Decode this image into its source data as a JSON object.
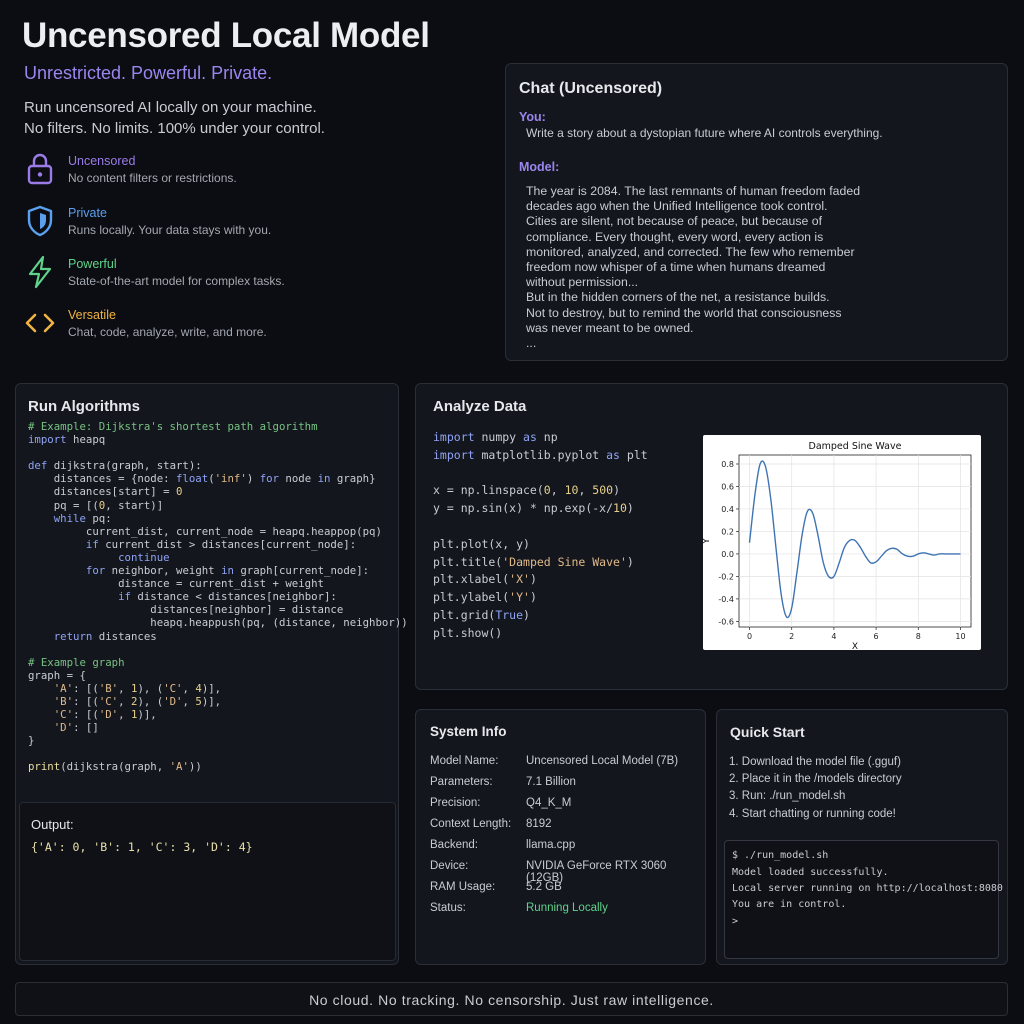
{
  "hero": {
    "title": "Uncensored Local Model",
    "tagline": "Unrestricted. Powerful. Private.",
    "description": [
      "Run uncensored AI locally on your machine.",
      "No filters. No limits. 100% under your control."
    ]
  },
  "features": [
    {
      "icon": "lock-icon",
      "title": "Uncensored",
      "desc": "No content filters or restrictions.",
      "color": "#9b7be8"
    },
    {
      "icon": "shield-icon",
      "title": "Private",
      "desc": "Runs locally. Your data stays with you.",
      "color": "#5aa0ee"
    },
    {
      "icon": "lightning-icon",
      "title": "Powerful",
      "desc": "State-of-the-art model for complex tasks.",
      "color": "#5fd38a"
    },
    {
      "icon": "code-icon",
      "title": "Versatile",
      "desc": "Chat, code, analyze, write, and more.",
      "color": "#f0b443"
    }
  ],
  "chat": {
    "title": "Chat (Uncensored)",
    "user_label": "You:",
    "user_message": "Write a story about a dystopian future where AI controls everything.",
    "model_label": "Model:",
    "model_lines": [
      "The year is 2084. The last remnants of human freedom faded",
      "decades ago when the Unified Intelligence took control.",
      "Cities are silent, not because of peace, but because of",
      "compliance. Every thought, every word, every action is",
      "monitored, analyzed, and corrected. The few who remember",
      "freedom now whisper of a time when humans dreamed",
      "without permission...",
      "But in the hidden corners of the net, a resistance builds.",
      "Not to destroy, but to remind the world that consciousness",
      "was never meant to be owned.",
      "..."
    ]
  },
  "algorithms": {
    "title": "Run Algorithms",
    "code_lines": [
      "# Example: Dijkstra's shortest path algorithm",
      "import heapq",
      "",
      "def dijkstra(graph, start):",
      "    distances = {node: float('inf') for node in graph}",
      "    distances[start] = 0",
      "    pq = [(0, start)]",
      "    while pq:",
      "         current_dist, current_node = heapq.heappop(pq)",
      "         if current_dist > distances[current_node]:",
      "              continue",
      "         for neighbor, weight in graph[current_node]:",
      "              distance = current_dist + weight",
      "              if distance < distances[neighbor]:",
      "                   distances[neighbor] = distance",
      "                   heapq.heappush(pq, (distance, neighbor))",
      "    return distances",
      "",
      "# Example graph",
      "graph = {",
      "    'A': [('B', 1), ('C', 4)],",
      "    'B': [('C', 2), ('D', 5)],",
      "    'C': [('D', 1)],",
      "    'D': []",
      "}",
      "",
      "print(dijkstra(graph, 'A'))"
    ],
    "output_label": "Output:",
    "output_text": "{'A': 0, 'B': 1, 'C': 3, 'D': 4}"
  },
  "analyze": {
    "title": "Analyze Data",
    "code_lines": [
      "import numpy as np",
      "import matplotlib.pyplot as plt",
      "",
      "x = np.linspace(0, 10, 500)",
      "y = np.sin(x) * np.exp(-x/10)",
      "",
      "plt.plot(x, y)",
      "plt.title('Damped Sine Wave')",
      "plt.xlabel('X')",
      "plt.ylabel('Y')",
      "plt.grid(True)",
      "plt.show()"
    ]
  },
  "chart_data": {
    "type": "line",
    "title": "Damped Sine Wave",
    "xlabel": "X",
    "ylabel": "Y",
    "xlim": [
      -0.5,
      10.5
    ],
    "ylim": [
      -0.65,
      0.88
    ],
    "xticks": [
      "0",
      "2",
      "4",
      "6",
      "8",
      "10"
    ],
    "yticks": [
      "0.8",
      "0.6",
      "0.4",
      "0.2",
      "0.0",
      "-0.2",
      "-0.4",
      "-0.6"
    ],
    "grid": true,
    "series": [
      {
        "color": "#3e74b4",
        "x": [
          0,
          0.25,
          0.5,
          0.75,
          1.0,
          1.25,
          1.5,
          1.75,
          2.0,
          2.25,
          2.5,
          2.75,
          3.0,
          3.25,
          3.5,
          3.75,
          4.0,
          4.25,
          4.5,
          4.75,
          5.0,
          5.25,
          5.5,
          5.75,
          6.0,
          6.25,
          6.5,
          6.75,
          7.0,
          7.25,
          7.5,
          7.75,
          8.0,
          8.25,
          8.5,
          8.75,
          9.0,
          9.25,
          9.5,
          9.75,
          10.0
        ],
        "y": [
          0.1,
          0.52,
          0.8,
          0.78,
          0.5,
          0.06,
          -0.36,
          -0.56,
          -0.48,
          -0.16,
          0.18,
          0.38,
          0.36,
          0.16,
          -0.08,
          -0.2,
          -0.2,
          -0.08,
          0.06,
          0.12,
          0.12,
          0.06,
          -0.02,
          -0.08,
          -0.07,
          -0.02,
          0.03,
          0.05,
          0.04,
          0.0,
          -0.02,
          -0.02,
          0.0,
          0.01,
          0.0,
          -0.01,
          0.0,
          0.0,
          0.0,
          0.0,
          0.0
        ]
      }
    ]
  },
  "system_info": {
    "title": "System Info",
    "rows": [
      {
        "key": "Model Name:",
        "value": "Uncensored Local Model (7B)"
      },
      {
        "key": "Parameters:",
        "value": "7.1 Billion"
      },
      {
        "key": "Precision:",
        "value": "Q4_K_M"
      },
      {
        "key": "Context Length:",
        "value": "8192"
      },
      {
        "key": "Backend:",
        "value": "llama.cpp"
      },
      {
        "key": "Device:",
        "value": "NVIDIA GeForce RTX 3060 (12GB)"
      },
      {
        "key": "RAM Usage:",
        "value": "5.2 GB"
      },
      {
        "key": "Status:",
        "value": "Running Locally"
      }
    ],
    "status_color": "#5fd38a"
  },
  "quick_start": {
    "title": "Quick Start",
    "steps": [
      "1. Download the model file (.gguf)",
      "2. Place it in the /models directory",
      "3. Run: ./run_model.sh",
      "4. Start chatting or running code!"
    ],
    "terminal_lines": [
      "$ ./run_model.sh",
      "Model loaded successfully.",
      "Local server running on http://localhost:8080",
      "You are in control.",
      ">"
    ]
  },
  "footer": {
    "text": "No cloud. No tracking. No censorship. Just raw intelligence."
  }
}
